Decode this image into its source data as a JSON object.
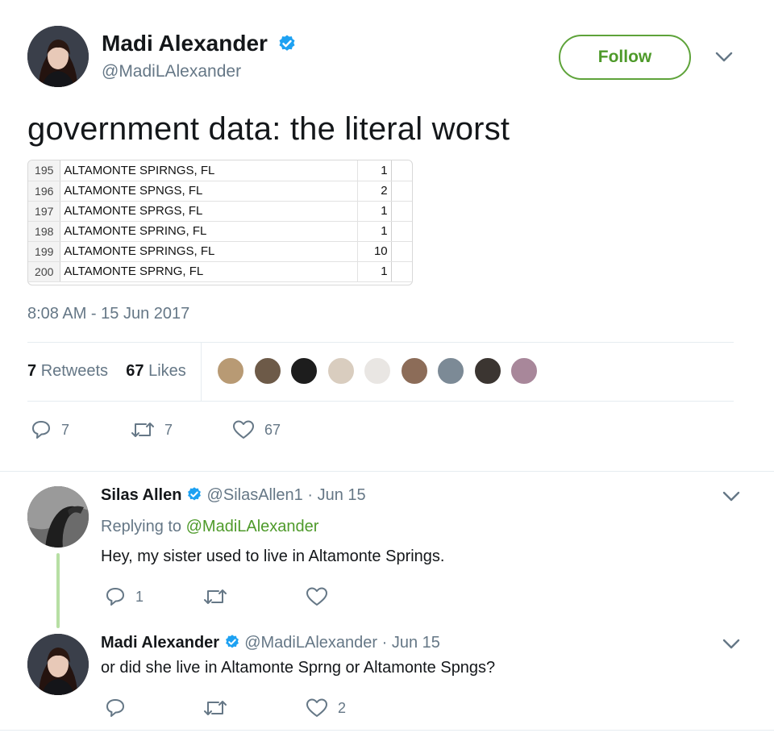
{
  "tweet": {
    "author_name": "Madi Alexander",
    "author_handle": "@MadiLAlexander",
    "follow_label": "Follow",
    "text": "government data: the literal worst",
    "timestamp": "8:08 AM - 15 Jun 2017",
    "retweets_count": "7",
    "retweets_label": "Retweets",
    "likes_count": "67",
    "likes_label": "Likes",
    "actions": {
      "reply_count": "7",
      "retweet_count": "7",
      "like_count": "67"
    }
  },
  "spreadsheet": {
    "rows": [
      {
        "row": "195",
        "city": "ALTAMONTE SPIRNGS, FL",
        "count": "1"
      },
      {
        "row": "196",
        "city": "ALTAMONTE SPNGS, FL",
        "count": "2"
      },
      {
        "row": "197",
        "city": "ALTAMONTE SPRGS, FL",
        "count": "1"
      },
      {
        "row": "198",
        "city": "ALTAMONTE SPRING, FL",
        "count": "1"
      },
      {
        "row": "199",
        "city": "ALTAMONTE SPRINGS, FL",
        "count": "10"
      },
      {
        "row": "200",
        "city": "ALTAMONTE SPRNG, FL",
        "count": "1"
      }
    ]
  },
  "likers": [
    {
      "icon": "liker-avatar-1",
      "color": "#b89a74"
    },
    {
      "icon": "liker-avatar-2",
      "color": "#6d5a48"
    },
    {
      "icon": "liker-avatar-3",
      "color": "#1d1d1d"
    },
    {
      "icon": "liker-avatar-4",
      "color": "#d9cdbf"
    },
    {
      "icon": "liker-avatar-5",
      "color": "#e9e6e3"
    },
    {
      "icon": "liker-avatar-6",
      "color": "#8c6c58"
    },
    {
      "icon": "liker-avatar-7",
      "color": "#7c8a96"
    },
    {
      "icon": "liker-avatar-8",
      "color": "#3b3531"
    },
    {
      "icon": "liker-avatar-9",
      "color": "#a8879a"
    }
  ],
  "replies": [
    {
      "name": "Silas Allen",
      "handle": "@SilasAllen1",
      "date": "· Jun 15",
      "replying_prefix": "Replying to",
      "replying_to": "@MadiLAlexander",
      "text": "Hey, my sister used to live in Altamonte Springs.",
      "reply_count": "1",
      "retweet_count": "",
      "like_count": ""
    },
    {
      "name": "Madi Alexander",
      "handle": "@MadiLAlexander",
      "date": "· Jun 15",
      "text": "or did she live in Altamonte Sprng or Altamonte Spngs?",
      "reply_count": "",
      "retweet_count": "",
      "like_count": "2"
    }
  ],
  "colors": {
    "accent": "#4e9a2a",
    "verified": "#1da1f2",
    "muted": "#657786",
    "thread": "#b7dfa4"
  }
}
